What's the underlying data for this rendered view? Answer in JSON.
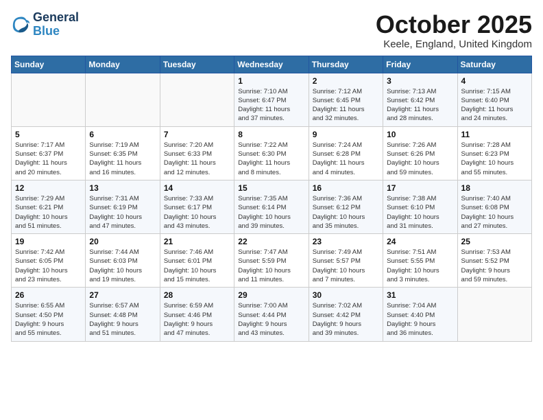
{
  "header": {
    "logo_line1": "General",
    "logo_line2": "Blue",
    "month": "October 2025",
    "location": "Keele, England, United Kingdom"
  },
  "weekdays": [
    "Sunday",
    "Monday",
    "Tuesday",
    "Wednesday",
    "Thursday",
    "Friday",
    "Saturday"
  ],
  "weeks": [
    [
      {
        "day": "",
        "info": ""
      },
      {
        "day": "",
        "info": ""
      },
      {
        "day": "",
        "info": ""
      },
      {
        "day": "1",
        "info": "Sunrise: 7:10 AM\nSunset: 6:47 PM\nDaylight: 11 hours\nand 37 minutes."
      },
      {
        "day": "2",
        "info": "Sunrise: 7:12 AM\nSunset: 6:45 PM\nDaylight: 11 hours\nand 32 minutes."
      },
      {
        "day": "3",
        "info": "Sunrise: 7:13 AM\nSunset: 6:42 PM\nDaylight: 11 hours\nand 28 minutes."
      },
      {
        "day": "4",
        "info": "Sunrise: 7:15 AM\nSunset: 6:40 PM\nDaylight: 11 hours\nand 24 minutes."
      }
    ],
    [
      {
        "day": "5",
        "info": "Sunrise: 7:17 AM\nSunset: 6:37 PM\nDaylight: 11 hours\nand 20 minutes."
      },
      {
        "day": "6",
        "info": "Sunrise: 7:19 AM\nSunset: 6:35 PM\nDaylight: 11 hours\nand 16 minutes."
      },
      {
        "day": "7",
        "info": "Sunrise: 7:20 AM\nSunset: 6:33 PM\nDaylight: 11 hours\nand 12 minutes."
      },
      {
        "day": "8",
        "info": "Sunrise: 7:22 AM\nSunset: 6:30 PM\nDaylight: 11 hours\nand 8 minutes."
      },
      {
        "day": "9",
        "info": "Sunrise: 7:24 AM\nSunset: 6:28 PM\nDaylight: 11 hours\nand 4 minutes."
      },
      {
        "day": "10",
        "info": "Sunrise: 7:26 AM\nSunset: 6:26 PM\nDaylight: 10 hours\nand 59 minutes."
      },
      {
        "day": "11",
        "info": "Sunrise: 7:28 AM\nSunset: 6:23 PM\nDaylight: 10 hours\nand 55 minutes."
      }
    ],
    [
      {
        "day": "12",
        "info": "Sunrise: 7:29 AM\nSunset: 6:21 PM\nDaylight: 10 hours\nand 51 minutes."
      },
      {
        "day": "13",
        "info": "Sunrise: 7:31 AM\nSunset: 6:19 PM\nDaylight: 10 hours\nand 47 minutes."
      },
      {
        "day": "14",
        "info": "Sunrise: 7:33 AM\nSunset: 6:17 PM\nDaylight: 10 hours\nand 43 minutes."
      },
      {
        "day": "15",
        "info": "Sunrise: 7:35 AM\nSunset: 6:14 PM\nDaylight: 10 hours\nand 39 minutes."
      },
      {
        "day": "16",
        "info": "Sunrise: 7:36 AM\nSunset: 6:12 PM\nDaylight: 10 hours\nand 35 minutes."
      },
      {
        "day": "17",
        "info": "Sunrise: 7:38 AM\nSunset: 6:10 PM\nDaylight: 10 hours\nand 31 minutes."
      },
      {
        "day": "18",
        "info": "Sunrise: 7:40 AM\nSunset: 6:08 PM\nDaylight: 10 hours\nand 27 minutes."
      }
    ],
    [
      {
        "day": "19",
        "info": "Sunrise: 7:42 AM\nSunset: 6:05 PM\nDaylight: 10 hours\nand 23 minutes."
      },
      {
        "day": "20",
        "info": "Sunrise: 7:44 AM\nSunset: 6:03 PM\nDaylight: 10 hours\nand 19 minutes."
      },
      {
        "day": "21",
        "info": "Sunrise: 7:46 AM\nSunset: 6:01 PM\nDaylight: 10 hours\nand 15 minutes."
      },
      {
        "day": "22",
        "info": "Sunrise: 7:47 AM\nSunset: 5:59 PM\nDaylight: 10 hours\nand 11 minutes."
      },
      {
        "day": "23",
        "info": "Sunrise: 7:49 AM\nSunset: 5:57 PM\nDaylight: 10 hours\nand 7 minutes."
      },
      {
        "day": "24",
        "info": "Sunrise: 7:51 AM\nSunset: 5:55 PM\nDaylight: 10 hours\nand 3 minutes."
      },
      {
        "day": "25",
        "info": "Sunrise: 7:53 AM\nSunset: 5:52 PM\nDaylight: 9 hours\nand 59 minutes."
      }
    ],
    [
      {
        "day": "26",
        "info": "Sunrise: 6:55 AM\nSunset: 4:50 PM\nDaylight: 9 hours\nand 55 minutes."
      },
      {
        "day": "27",
        "info": "Sunrise: 6:57 AM\nSunset: 4:48 PM\nDaylight: 9 hours\nand 51 minutes."
      },
      {
        "day": "28",
        "info": "Sunrise: 6:59 AM\nSunset: 4:46 PM\nDaylight: 9 hours\nand 47 minutes."
      },
      {
        "day": "29",
        "info": "Sunrise: 7:00 AM\nSunset: 4:44 PM\nDaylight: 9 hours\nand 43 minutes."
      },
      {
        "day": "30",
        "info": "Sunrise: 7:02 AM\nSunset: 4:42 PM\nDaylight: 9 hours\nand 39 minutes."
      },
      {
        "day": "31",
        "info": "Sunrise: 7:04 AM\nSunset: 4:40 PM\nDaylight: 9 hours\nand 36 minutes."
      },
      {
        "day": "",
        "info": ""
      }
    ]
  ]
}
